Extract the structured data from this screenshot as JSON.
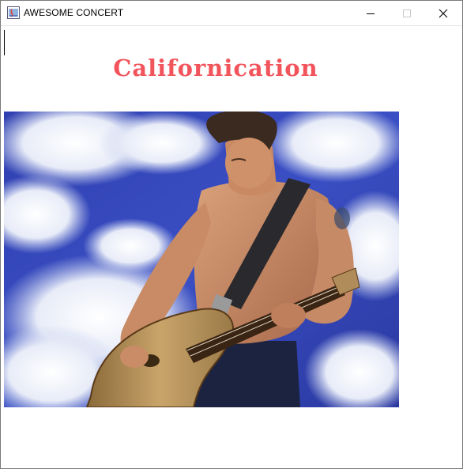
{
  "window": {
    "title": "AWESOME CONCERT",
    "app_icon": "java-window-icon",
    "controls": [
      "minimize-icon",
      "maximize-icon",
      "close-icon"
    ]
  },
  "content": {
    "heading": "Californication",
    "heading_color": "#f2545b",
    "image": "guitarist playing a hollow-body electric guitar in front of a blue sky with clouds"
  }
}
